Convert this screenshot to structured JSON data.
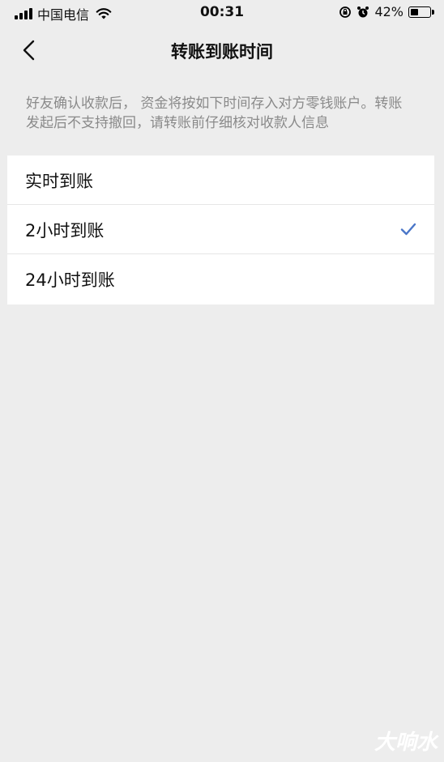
{
  "status_bar": {
    "carrier": "中国电信",
    "time": "00:31",
    "battery_percent": "42%",
    "battery_level": 0.42,
    "icons": [
      "signal-icon",
      "wifi-icon",
      "rotation-lock-icon",
      "alarm-icon",
      "battery-icon"
    ]
  },
  "nav": {
    "title": "转账到账时间",
    "back_icon": "chevron-left-icon"
  },
  "notice": {
    "text": "好友确认收款后， 资金将按如下时间存入对方零钱账户。转账发起后不支持撤回，请转账前仔细核对收款人信息"
  },
  "options": [
    {
      "label": "实时到账",
      "selected": false
    },
    {
      "label": "2小时到账",
      "selected": true
    },
    {
      "label": "24小时到账",
      "selected": false
    }
  ],
  "watermark": "大响水",
  "colors": {
    "background": "#ededed",
    "notice_text": "#8a8a8a",
    "check_accent": "#4a76c8"
  }
}
